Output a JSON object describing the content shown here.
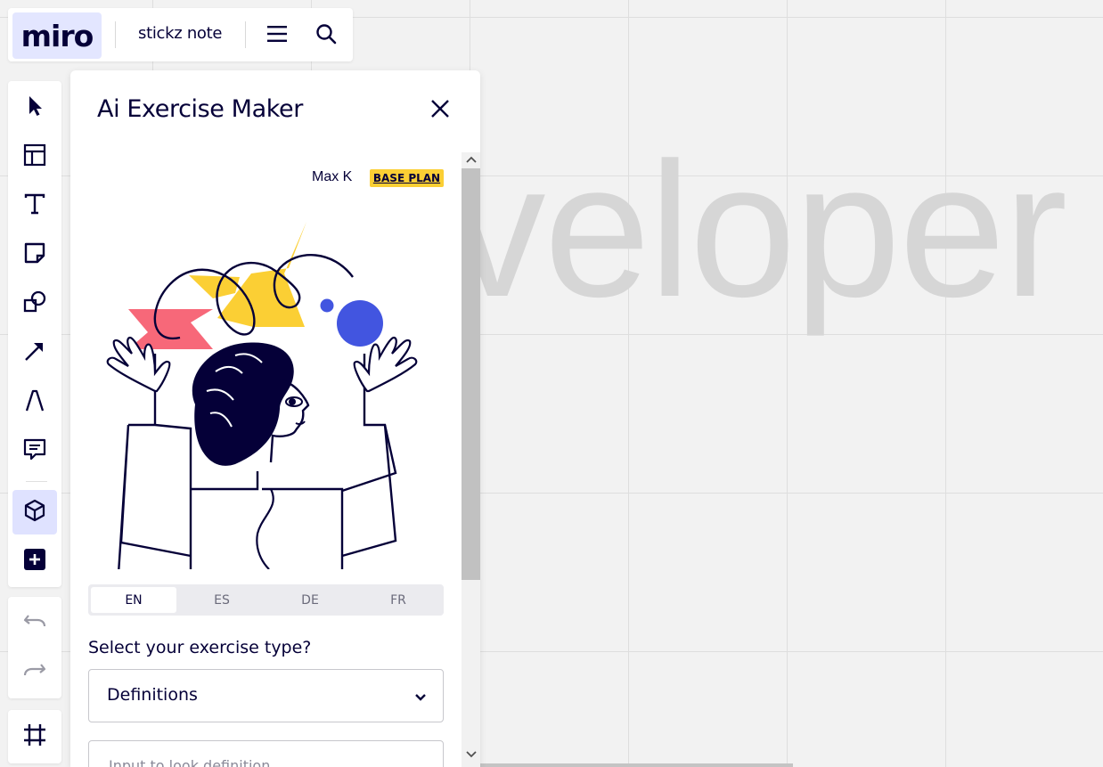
{
  "app": {
    "logo": "miro",
    "board_name": "stickz note",
    "canvas_text": "veloper"
  },
  "topbar": {
    "menu_icon": "hamburger-icon",
    "search_icon": "search-icon"
  },
  "toolbar": {
    "tools": [
      {
        "name": "select",
        "icon": "cursor-icon"
      },
      {
        "name": "templates",
        "icon": "layout-icon"
      },
      {
        "name": "text",
        "icon": "text-icon"
      },
      {
        "name": "sticky-note",
        "icon": "sticky-note-icon"
      },
      {
        "name": "shapes",
        "icon": "shapes-icon"
      },
      {
        "name": "connection-line",
        "icon": "arrow-icon"
      },
      {
        "name": "pen",
        "icon": "pen-icon"
      },
      {
        "name": "comment",
        "icon": "comment-icon"
      },
      {
        "name": "apps",
        "icon": "cube-icon",
        "active": true
      },
      {
        "name": "more",
        "icon": "plus-icon"
      }
    ],
    "undo_icon": "undo-icon",
    "redo_icon": "redo-icon",
    "frames_icon": "frame-icon"
  },
  "panel": {
    "title": "Ai Exercise Maker",
    "close_icon": "close-icon",
    "user_name": "Max K",
    "plan_badge": "BASE PLAN",
    "languages": [
      "EN",
      "ES",
      "DE",
      "FR"
    ],
    "active_language": "EN",
    "exercise_label": "Select your exercise type?",
    "exercise_type": "Definitions",
    "input_placeholder": "Input to look definition",
    "colors": {
      "accent_blue": "#4255e0",
      "yellow": "#fbcf34",
      "coral": "#f76879",
      "navy": "#050038"
    }
  }
}
